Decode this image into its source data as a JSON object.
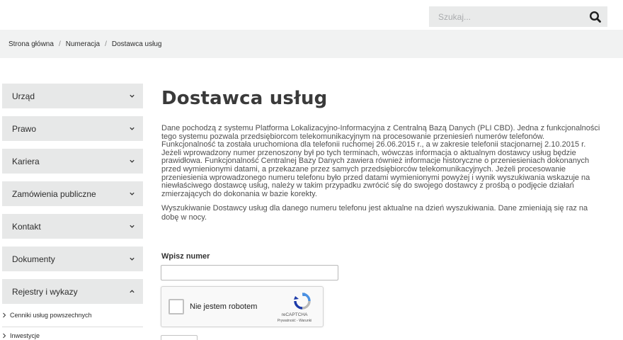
{
  "search": {
    "placeholder": "Szukaj..."
  },
  "breadcrumb": [
    "Strona główna",
    "Numeracja",
    "Dostawca usług"
  ],
  "sidebar": {
    "items": [
      {
        "label": "Urząd",
        "expanded": false
      },
      {
        "label": "Prawo",
        "expanded": false
      },
      {
        "label": "Kariera",
        "expanded": false
      },
      {
        "label": "Zamówienia publiczne",
        "expanded": false
      },
      {
        "label": "Kontakt",
        "expanded": false
      },
      {
        "label": "Dokumenty",
        "expanded": false
      },
      {
        "label": "Rejestry i wykazy",
        "expanded": true
      }
    ],
    "subitems": [
      "Cenniki usług powszechnych",
      "Inwestycje"
    ]
  },
  "main": {
    "title": "Dostawca usług",
    "paragraph1": "Dane pochodzą z systemu Platforma Lokalizacyjno-Informacyjna z Centralną Bazą Danych (PLI CBD). Jedna z funkcjonalności tego systemu pozwala przedsiębiorcom telekomunikacyjnym na procesowanie przeniesień numerów telefonów. Funkcjonalność ta została uruchomiona dla telefonii ruchomej 26.06.2015 r., a w zakresie telefonii stacjonarnej 2.10.2015 r. Jeżeli wprowadzony numer przenoszony był po tych terminach, wówczas informacja o aktualnym dostawcy usług będzie prawidłowa. Funkcjonalność Centralnej Bazy Danych zawiera również informacje historyczne o przeniesieniach dokonanych przed wymienionymi datami, a przekazane przez samych przedsiębiorców telekomunikacyjnych. Jeżeli procesowanie przeniesienia wprowadzonego numeru telefonu było przed datami wymienionymi powyżej i wynik wyszukiwania wskazuje na niewłaściwego dostawcę usług, należy w takim przypadku zwrócić się do swojego dostawcy z prośbą o podjęcie działań zmierzających do dokonania w bazie korekty.",
    "paragraph2": "Wyszukiwanie Dostawcy usług dla danego numeru telefonu jest aktualne na dzień wyszukiwania. Dane zmieniają się raz na dobę w nocy.",
    "input_label": "Wpisz numer",
    "input_value": ""
  },
  "captcha": {
    "label": "Nie jestem robotem",
    "brand": "reCAPTCHA",
    "links": "Prywatność - Warunki",
    "checked": false
  },
  "icons": {
    "search": "search-icon",
    "chevron_down": "chevron-down-icon",
    "chevron_up": "chevron-up-icon",
    "arrow_right": "chevron-right-icon",
    "recaptcha": "recaptcha-logo-icon"
  },
  "colors": {
    "menu_bg": "#e7e8e8",
    "breadcrumb_bg": "#f1f2f2",
    "search_bg": "#e9eaea",
    "title": "#3a3a3a"
  }
}
